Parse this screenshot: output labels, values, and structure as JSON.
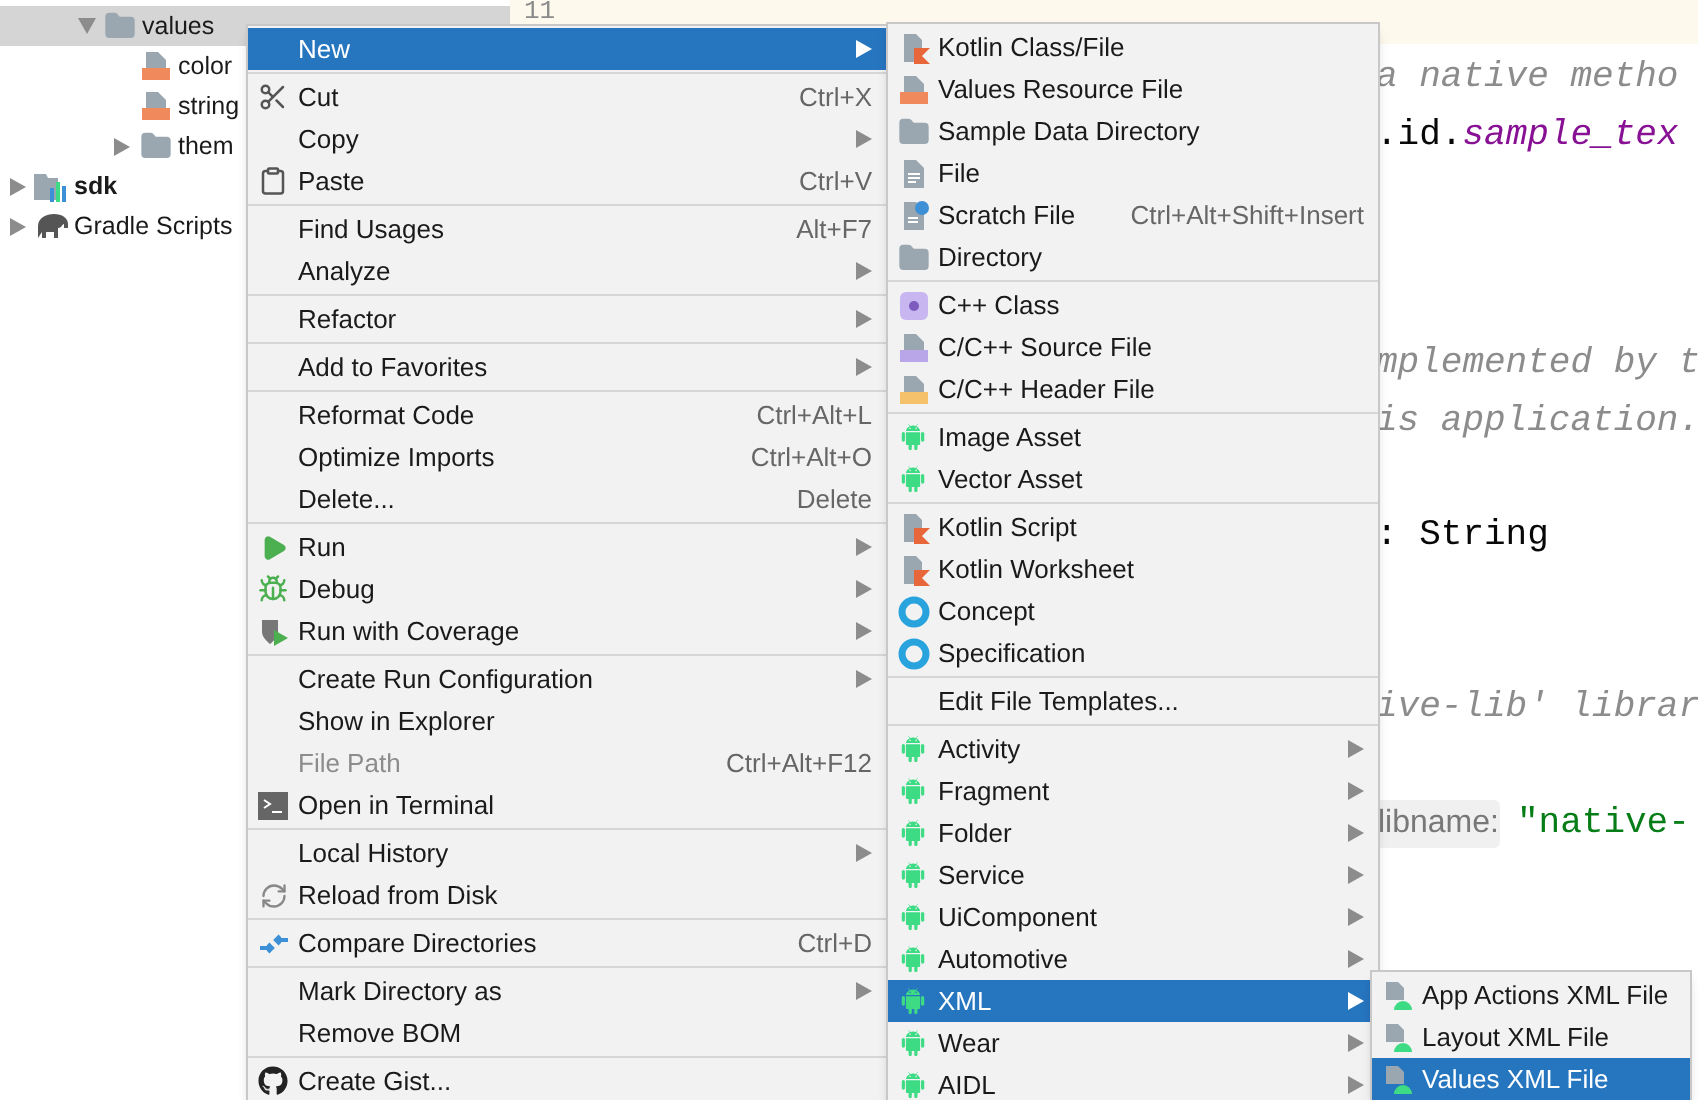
{
  "project_tree": {
    "nested_items": [
      {
        "label": "values",
        "kind": "folder",
        "expanded": true,
        "selected": true,
        "children": [
          {
            "label": "color",
            "kind": "xml_file",
            "selected": false
          },
          {
            "label": "string",
            "kind": "xml_file",
            "selected": false
          },
          {
            "label": "them",
            "kind": "folder",
            "expanded": false,
            "selected": false
          }
        ]
      }
    ],
    "root_items": [
      {
        "label": "sdk",
        "kind": "module",
        "expanded": false,
        "selected": false
      },
      {
        "label": "Gradle Scripts",
        "kind": "gradle",
        "expanded": false,
        "selected": false
      }
    ]
  },
  "editor": {
    "current_line_number": "11",
    "lines": [
      {
        "segments": [
          {
            "kind": "comment",
            "text": "a native metho"
          }
        ]
      },
      {
        "segments": [
          {
            "kind": "code",
            "text": ".id."
          },
          {
            "kind": "field",
            "text": "sample_tex"
          }
        ]
      },
      {
        "segments": [
          {
            "kind": "comment",
            "text": "mplemented by t"
          }
        ]
      },
      {
        "segments": [
          {
            "kind": "comment",
            "text": "is application."
          }
        ]
      },
      {
        "segments": [
          {
            "kind": "code",
            "text": ": String"
          }
        ]
      },
      {
        "segments": [
          {
            "kind": "comment",
            "text": "ive-lib' librar"
          }
        ]
      },
      {
        "segments": [
          {
            "kind": "hint",
            "text": "libname:"
          },
          {
            "kind": "string",
            "text": "\"native-"
          }
        ]
      }
    ]
  },
  "context_menu": {
    "groups": [
      [
        {
          "label": "New",
          "submenu": true,
          "selected": true,
          "disabled": false
        }
      ],
      [
        {
          "label": "Cut",
          "shortcut": "Ctrl+X",
          "submenu": false,
          "selected": false,
          "disabled": false
        },
        {
          "label": "Copy",
          "submenu": true,
          "selected": false,
          "disabled": false
        },
        {
          "label": "Paste",
          "shortcut": "Ctrl+V",
          "submenu": false,
          "selected": false,
          "disabled": false
        }
      ],
      [
        {
          "label": "Find Usages",
          "shortcut": "Alt+F7",
          "submenu": false,
          "selected": false,
          "disabled": false
        },
        {
          "label": "Analyze",
          "submenu": true,
          "selected": false,
          "disabled": false
        }
      ],
      [
        {
          "label": "Refactor",
          "submenu": true,
          "selected": false,
          "disabled": false
        }
      ],
      [
        {
          "label": "Add to Favorites",
          "submenu": true,
          "selected": false,
          "disabled": false
        }
      ],
      [
        {
          "label": "Reformat Code",
          "shortcut": "Ctrl+Alt+L",
          "submenu": false,
          "selected": false,
          "disabled": false
        },
        {
          "label": "Optimize Imports",
          "shortcut": "Ctrl+Alt+O",
          "submenu": false,
          "selected": false,
          "disabled": false
        },
        {
          "label": "Delete...",
          "shortcut": "Delete",
          "submenu": false,
          "selected": false,
          "disabled": false
        }
      ],
      [
        {
          "label": "Run",
          "submenu": true,
          "selected": false,
          "disabled": false
        },
        {
          "label": "Debug",
          "submenu": true,
          "selected": false,
          "disabled": false
        },
        {
          "label": "Run with Coverage",
          "submenu": true,
          "selected": false,
          "disabled": false
        }
      ],
      [
        {
          "label": "Create Run Configuration",
          "submenu": true,
          "selected": false,
          "disabled": false
        },
        {
          "label": "Show in Explorer",
          "submenu": false,
          "selected": false,
          "disabled": false
        },
        {
          "label": "File Path",
          "shortcut": "Ctrl+Alt+F12",
          "submenu": false,
          "selected": false,
          "disabled": true
        },
        {
          "label": "Open in Terminal",
          "submenu": false,
          "selected": false,
          "disabled": false
        }
      ],
      [
        {
          "label": "Local History",
          "submenu": true,
          "selected": false,
          "disabled": false
        },
        {
          "label": "Reload from Disk",
          "submenu": false,
          "selected": false,
          "disabled": false
        }
      ],
      [
        {
          "label": "Compare Directories",
          "shortcut": "Ctrl+D",
          "submenu": false,
          "selected": false,
          "disabled": false
        }
      ],
      [
        {
          "label": "Mark Directory as",
          "submenu": true,
          "selected": false,
          "disabled": false
        },
        {
          "label": "Remove BOM",
          "submenu": false,
          "selected": false,
          "disabled": false
        }
      ],
      [
        {
          "label": "Create Gist...",
          "submenu": false,
          "selected": false,
          "disabled": false
        }
      ]
    ]
  },
  "new_submenu": {
    "groups": [
      [
        {
          "label": "Kotlin Class/File",
          "submenu": false,
          "selected": false
        },
        {
          "label": "Values Resource File",
          "submenu": false,
          "selected": false
        },
        {
          "label": "Sample Data Directory",
          "submenu": false,
          "selected": false
        },
        {
          "label": "File",
          "submenu": false,
          "selected": false
        },
        {
          "label": "Scratch File",
          "shortcut": "Ctrl+Alt+Shift+Insert",
          "submenu": false,
          "selected": false
        },
        {
          "label": "Directory",
          "submenu": false,
          "selected": false
        }
      ],
      [
        {
          "label": "C++ Class",
          "submenu": false,
          "selected": false
        },
        {
          "label": "C/C++ Source File",
          "submenu": false,
          "selected": false
        },
        {
          "label": "C/C++ Header File",
          "submenu": false,
          "selected": false
        }
      ],
      [
        {
          "label": "Image Asset",
          "submenu": false,
          "selected": false
        },
        {
          "label": "Vector Asset",
          "submenu": false,
          "selected": false
        }
      ],
      [
        {
          "label": "Kotlin Script",
          "submenu": false,
          "selected": false
        },
        {
          "label": "Kotlin Worksheet",
          "submenu": false,
          "selected": false
        },
        {
          "label": "Concept",
          "submenu": false,
          "selected": false
        },
        {
          "label": "Specification",
          "submenu": false,
          "selected": false
        }
      ],
      [
        {
          "label": "Edit File Templates...",
          "submenu": false,
          "selected": false
        }
      ],
      [
        {
          "label": "Activity",
          "submenu": true,
          "selected": false
        },
        {
          "label": "Fragment",
          "submenu": true,
          "selected": false
        },
        {
          "label": "Folder",
          "submenu": true,
          "selected": false
        },
        {
          "label": "Service",
          "submenu": true,
          "selected": false
        },
        {
          "label": "UiComponent",
          "submenu": true,
          "selected": false
        },
        {
          "label": "Automotive",
          "submenu": true,
          "selected": false
        },
        {
          "label": "XML",
          "submenu": true,
          "selected": true
        },
        {
          "label": "Wear",
          "submenu": true,
          "selected": false
        },
        {
          "label": "AIDL",
          "submenu": true,
          "selected": false
        }
      ]
    ]
  },
  "xml_submenu": {
    "groups": [
      [
        {
          "label": "App Actions XML File",
          "submenu": false,
          "selected": false
        },
        {
          "label": "Layout XML File",
          "submenu": false,
          "selected": false
        },
        {
          "label": "Values XML File",
          "submenu": false,
          "selected": true
        }
      ]
    ]
  }
}
